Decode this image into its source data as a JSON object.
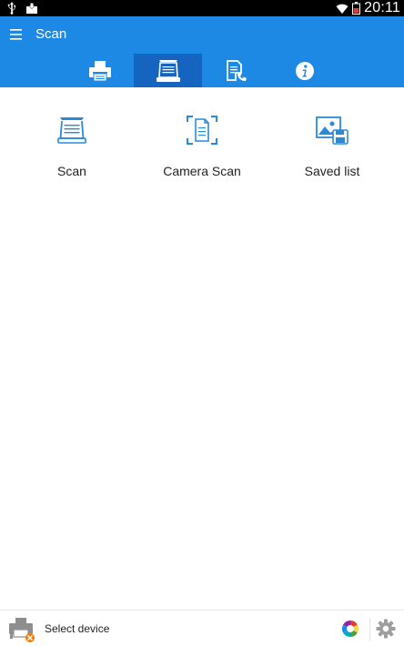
{
  "status_bar": {
    "time": "20:11",
    "icons": [
      "usb-icon",
      "download-notification-icon",
      "wifi-icon",
      "battery-icon"
    ]
  },
  "app_bar": {
    "title": "Scan",
    "menu_icon": "hamburger-menu-icon",
    "color": "#1e88e5",
    "active_tab_color": "#1565c0"
  },
  "tabs": [
    {
      "icon": "printer-icon",
      "active": false
    },
    {
      "icon": "scanner-icon",
      "active": true
    },
    {
      "icon": "fax-icon",
      "active": false
    },
    {
      "icon": "info-icon",
      "active": false
    }
  ],
  "features": [
    {
      "label": "Scan",
      "icon": "scanner-icon"
    },
    {
      "label": "Camera Scan",
      "icon": "camera-scan-icon"
    },
    {
      "label": "Saved list",
      "icon": "saved-list-icon"
    }
  ],
  "bottom_bar": {
    "device_label": "Select device",
    "printer_status_icon": "printer-disconnected-icon",
    "color_icon": "color-wheel-icon",
    "settings_icon": "gear-icon"
  },
  "accent_color": "#2a8ad8"
}
